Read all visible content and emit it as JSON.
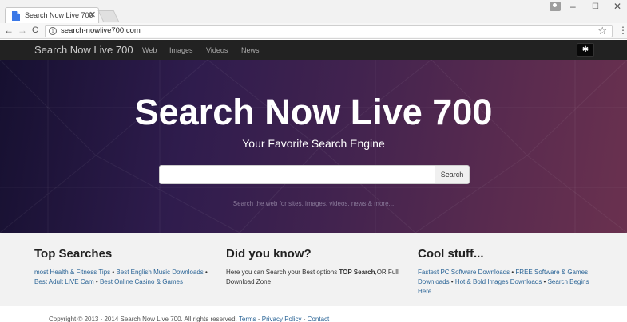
{
  "browser": {
    "tab_title": "Search Now Live 700",
    "tab_close": "✕",
    "url": "search-nowlive700.com",
    "win_min": "–",
    "win_max": "☐",
    "win_close": "✕",
    "back": "←",
    "forward": "→",
    "reload": "C",
    "star": "☆",
    "menu": "⋮",
    "info": "i"
  },
  "navbar": {
    "brand": "Search Now Live 700",
    "links": [
      "Web",
      "Images",
      "Videos",
      "News"
    ],
    "settings_icon": "✱"
  },
  "hero": {
    "title": "Search Now Live 700",
    "subtitle": "Your Favorite Search Engine",
    "search_value": "",
    "search_button": "Search",
    "hint": "Search the web for sites, images, videos, news & more..."
  },
  "columns": {
    "top_searches": {
      "title": "Top Searches",
      "links": [
        "most Health & Fitness Tips",
        "Best English Music Downloads",
        "Best Adult LIVE Cam",
        "Best Online Casino & Games"
      ],
      "sep": " • "
    },
    "did_you_know": {
      "title": "Did you know?",
      "text_before": "Here you can Search your Best options ",
      "bold": "TOP Search",
      "text_after": ",OR Full Download Zone"
    },
    "cool_stuff": {
      "title": "Cool stuff...",
      "links": [
        "Fastest PC Software Downloads",
        "FREE Software & Games Downloads",
        "Hot & Bold Images Downloads",
        "Search Begins Here"
      ],
      "sep": " • "
    }
  },
  "footer": {
    "copyright": "Copyright © 2013 - 2014 Search Now Live 700. All rights reserved. ",
    "terms": "Terms",
    "sep": " - ",
    "privacy": "Privacy Policy",
    "contact": "Contact"
  }
}
